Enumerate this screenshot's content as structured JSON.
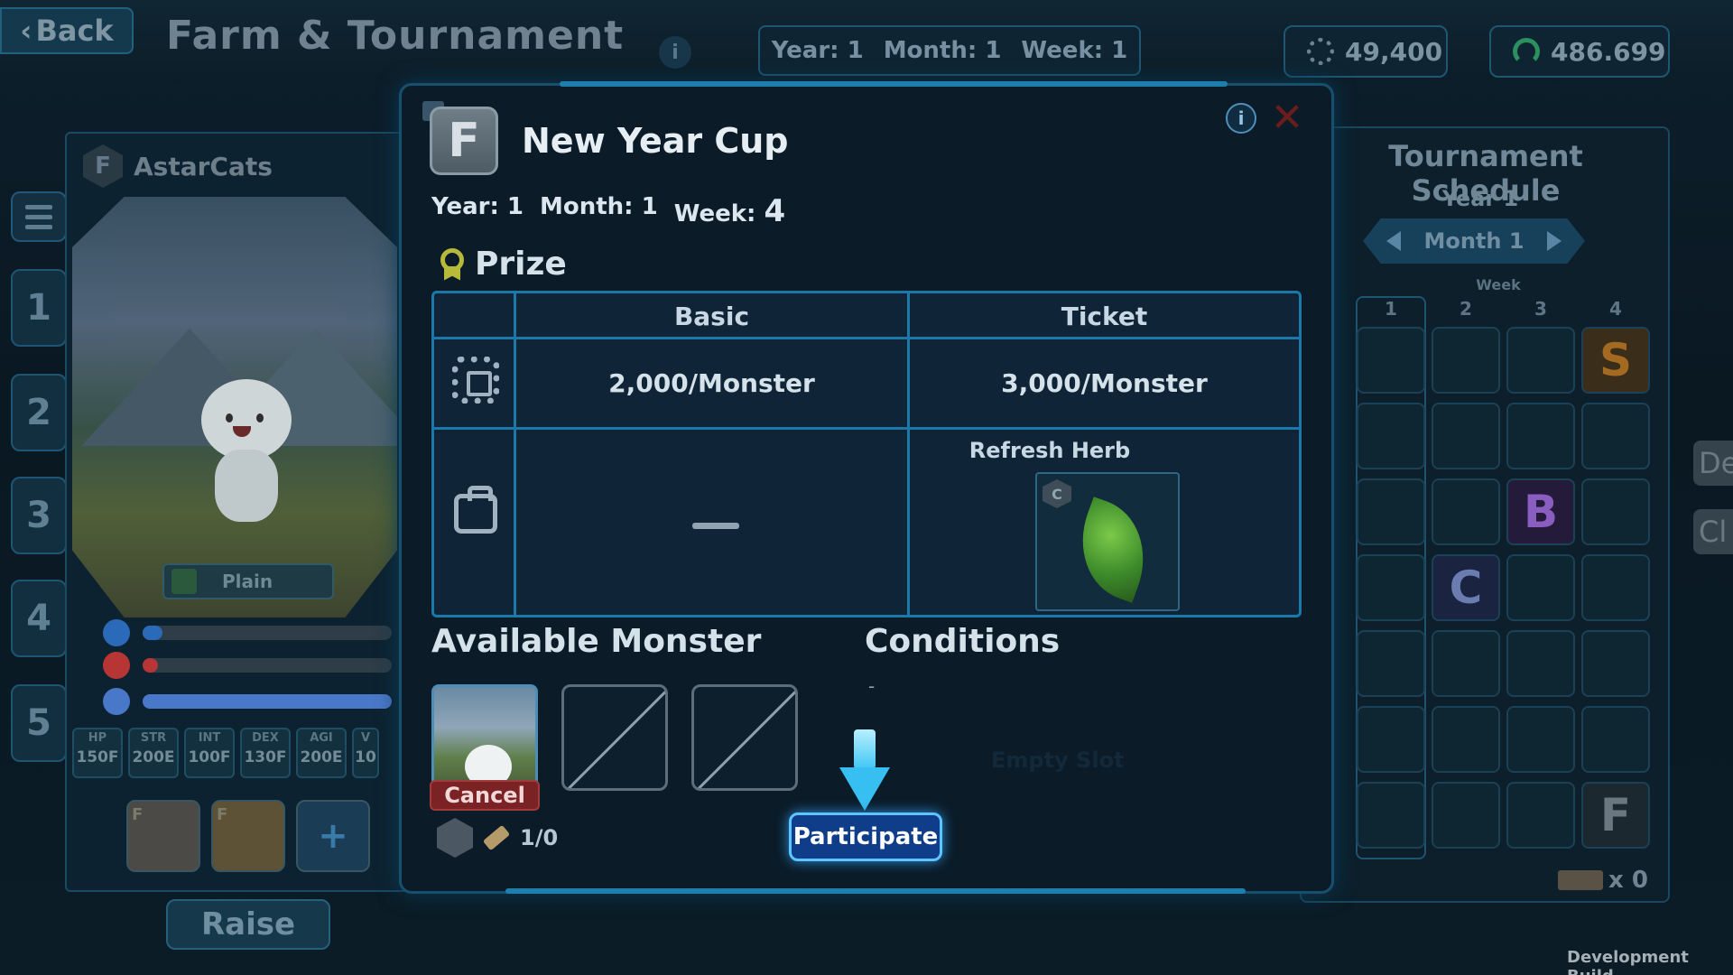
{
  "header": {
    "back_label": "Back",
    "title": "Farm & Tournament",
    "info_icon": "i",
    "date": {
      "year": "Year: 1",
      "month": "Month: 1",
      "week": "Week: 1"
    },
    "currency_gold": "49,400",
    "currency_green": "486.699"
  },
  "left": {
    "slots": [
      "1",
      "2",
      "3",
      "4",
      "5"
    ],
    "monster": {
      "rank": "F",
      "name": "AstarCats",
      "terrain": "Plain",
      "mood_colors": [
        "#2a6ab8",
        "#b83535",
        "#4a78c8"
      ],
      "mood_levels": [
        0.08,
        0.06,
        1.0
      ],
      "stats": [
        {
          "key": "HP",
          "value": "150F"
        },
        {
          "key": "STR",
          "value": "200E"
        },
        {
          "key": "INT",
          "value": "100F"
        },
        {
          "key": "DEX",
          "value": "130F"
        },
        {
          "key": "AGI",
          "value": "200E"
        },
        {
          "key": "V",
          "value": "10"
        }
      ],
      "skills": [
        "F",
        "F"
      ]
    },
    "raise_label": "Raise"
  },
  "schedule": {
    "title": "Tournament Schedule",
    "year": "Year 1",
    "month": "Month 1",
    "week_label": "Week",
    "weeks": [
      "1",
      "2",
      "3",
      "4"
    ],
    "entries": [
      {
        "row": 0,
        "col": 3,
        "rank": "S",
        "color": "#a46a22",
        "bg": "#3a2d1a"
      },
      {
        "row": 2,
        "col": 2,
        "rank": "B",
        "color": "#8a5ec0",
        "bg": "#241a3a"
      },
      {
        "row": 3,
        "col": 1,
        "rank": "C",
        "color": "#6b7db0",
        "bg": "#1a2340"
      },
      {
        "row": 6,
        "col": 3,
        "rank": "F",
        "color": "#6a7780",
        "bg": "#1b2830"
      }
    ],
    "ticket_count": "x 0"
  },
  "side_buttons": [
    "De",
    "Cl"
  ],
  "modal": {
    "rank": "F",
    "name": "New Year Cup",
    "date": {
      "year": "Year: 1",
      "month": "Month: 1",
      "week_text": "Week:",
      "week_num": "4"
    },
    "prize_label": "Prize",
    "table": {
      "headers": [
        "Basic",
        "Ticket"
      ],
      "money_basic": "2,000/Monster",
      "money_ticket": "3,000/Monster",
      "item_ticket_name": "Refresh Herb",
      "item_ticket_rank": "C"
    },
    "available_label": "Available Monster",
    "conditions_label": "Conditions",
    "conditions_value": "-",
    "empty_slot_text": "Empty Slot",
    "cancel_label": "Cancel",
    "ticket_count": "1/0",
    "participate_label": "Participate"
  },
  "footer": {
    "build": "Development Build"
  }
}
